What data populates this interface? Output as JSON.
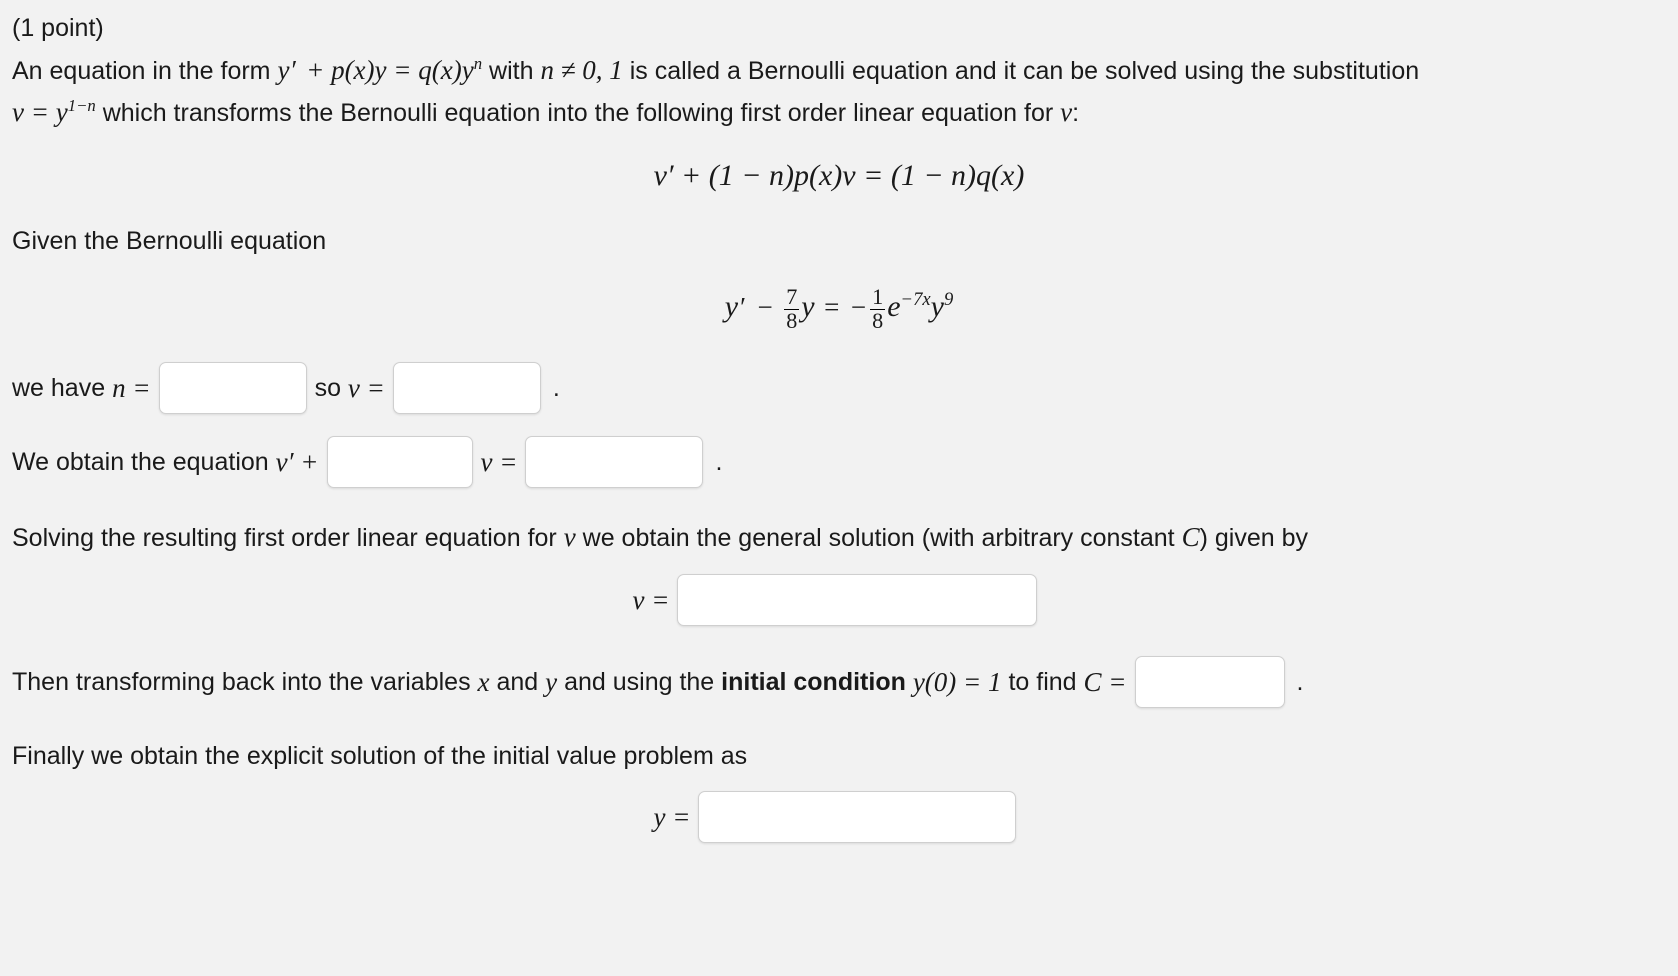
{
  "problem": {
    "points_label": "(1 point)",
    "intro_part1": "An equation in the form",
    "intro_math1_y": "y",
    "intro_math1_rest": "+ p(x)y = q(x)y",
    "intro_math1_exp": "n",
    "intro_part2": "with",
    "intro_math2": "n ≠ 0, 1",
    "intro_part3": "is called a Bernoulli equation and it can be solved using the substitution",
    "subst_v": "v",
    "subst_eq": "= y",
    "subst_exp": "1−n",
    "subst_tail": "which transforms the Bernoulli equation into the following first order linear equation for",
    "subst_tail_var": "v",
    "subst_tail_colon": ":",
    "display_eq_1": "v′ + (1 − n)p(x)v = (1 − n)q(x)",
    "given_label": "Given the Bernoulli equation",
    "bernoulli": {
      "lhs_y": "y",
      "prime": "′",
      "minus": "−",
      "coef_num": "7",
      "coef_den": "8",
      "lhs_var": "y",
      "equals": "=",
      "rhs_minus": "−",
      "rhs_num": "1",
      "rhs_den": "8",
      "rhs_e": "e",
      "rhs_exp": "−7x",
      "rhs_y": "y",
      "rhs_y_exp": "9"
    },
    "we_have_label": "we have",
    "we_have_n": "n =",
    "so_label": "so",
    "so_v": "v =",
    "period": ".",
    "obtain_label": "We obtain the equation",
    "obtain_vprime": "v′ +",
    "obtain_v_equals": "v =",
    "solving_text_a": "Solving the resulting first order linear equation for",
    "solving_var": "v",
    "solving_text_b": "we obtain the general solution (with arbitrary constant",
    "solving_const": "C",
    "solving_text_c": ") given by",
    "v_equals": "v =",
    "transform_a": "Then transforming back into the variables",
    "transform_x": "x",
    "transform_and": "and",
    "transform_y": "y",
    "transform_b": "and using the",
    "transform_bold": "initial condition",
    "transform_cond": "y(0) = 1",
    "transform_c": "to find",
    "transform_C": "C =",
    "finally_label": "Finally we obtain the explicit solution of the initial value problem as",
    "y_equals": "y ="
  },
  "inputs": {
    "n_value": "",
    "n_placeholder": "",
    "v_value": "",
    "v_placeholder": "",
    "coef_value": "",
    "coef_placeholder": "",
    "rhs_value": "",
    "rhs_placeholder": "",
    "general_v_value": "",
    "general_v_placeholder": "",
    "C_value": "",
    "C_placeholder": "",
    "explicit_y_value": "",
    "explicit_y_placeholder": ""
  },
  "colors": {
    "background": "#f2f2f2",
    "text": "#1a1a1a",
    "input_border": "#cfcfcf",
    "input_bg": "#ffffff"
  }
}
